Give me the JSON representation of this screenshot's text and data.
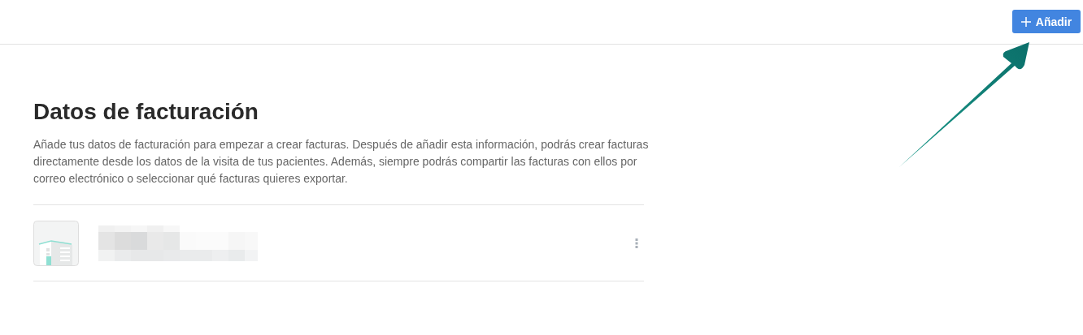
{
  "header": {
    "add_button": {
      "label": "Añadir"
    }
  },
  "section": {
    "title": "Datos de facturación",
    "description": "Añade tus datos de facturación para empezar a crear facturas. Después de añadir esta información, podrás crear facturas directamente desde los datos de la visita de tus pacientes. Además, siempre podrás compartir las facturas con ellos por correo electrónico o seleccionar qué facturas quieres exportar."
  }
}
